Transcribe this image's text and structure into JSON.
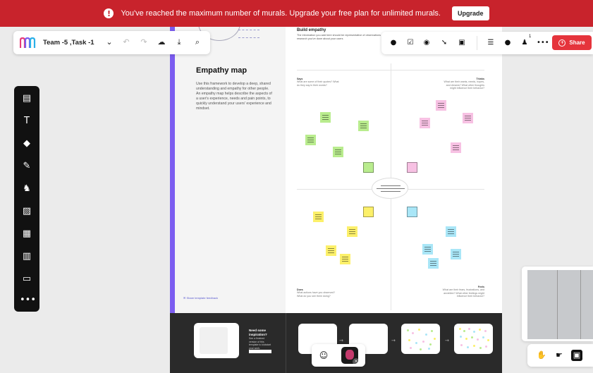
{
  "banner": {
    "message": "You've reached the maximum number of murals. Upgrade your free plan for unlimited murals.",
    "upgrade_label": "Upgrade",
    "color": "#c8232c"
  },
  "toolbar": {
    "mural_name": "Team -5 ,Task -1",
    "icons": [
      "mural-logo-icon",
      "chevron-down-icon",
      "undo-icon",
      "redo-icon",
      "cloud-sync-icon",
      "download-icon",
      "search-icon"
    ]
  },
  "toolbar_right": {
    "icons": [
      "timer-icon",
      "voting-icon",
      "private-mode-icon",
      "laser-pointer-icon",
      "lock-icon",
      "outline-icon",
      "comments-icon",
      "collaborators-icon",
      "more-icon"
    ],
    "collaborator_count": "1",
    "more_label": "•••",
    "share_label": "Share",
    "share_color": "#e5343c"
  },
  "rail": {
    "tools": [
      "sticky-note-icon",
      "text-icon",
      "shapes-icon",
      "pen-icon",
      "icons-llama-icon",
      "image-icon",
      "templates-icon",
      "table-icon",
      "frame-icon",
      "more-icon"
    ],
    "more_label": "•••"
  },
  "template": {
    "title": "Empathy map",
    "description": "Use this framework to develop a deep, shared understanding and empathy for other people. An empathy map helps describe the aspects of a user's experience, needs and pain points, to quickly understand your users' experience and mindset.",
    "feedback_link": "Share template feedback",
    "accent": "#7b5cf0"
  },
  "board": {
    "heading": "Build empathy",
    "subheading": "The information you add here should be representative of observations and research you've done about your users",
    "quadrants": {
      "says": {
        "title": "Says",
        "prompt": "What are some of their quotes? What do they say in their words?"
      },
      "thinks": {
        "title": "Thinks",
        "prompt": "What are their wants, needs, hopes, and dreams? What other thoughts might influence their behavior?"
      },
      "does": {
        "title": "Does",
        "prompt": "What actions have you observed? What do you see them doing?"
      },
      "feels": {
        "title": "Feels",
        "prompt": "What are their fears, frustrations, and anxieties? What other feelings might influence their behavior?"
      }
    }
  },
  "inspiration": {
    "title": "Need some inspiration?",
    "description": "See a finished version of this template to kickstart your work."
  },
  "reactions": {
    "icons": [
      "smile-icon",
      "avatar-icon",
      "close-icon"
    ]
  },
  "bottom_right_tools": {
    "icons": [
      "hand-icon",
      "select-icon",
      "outline-view-icon"
    ]
  }
}
